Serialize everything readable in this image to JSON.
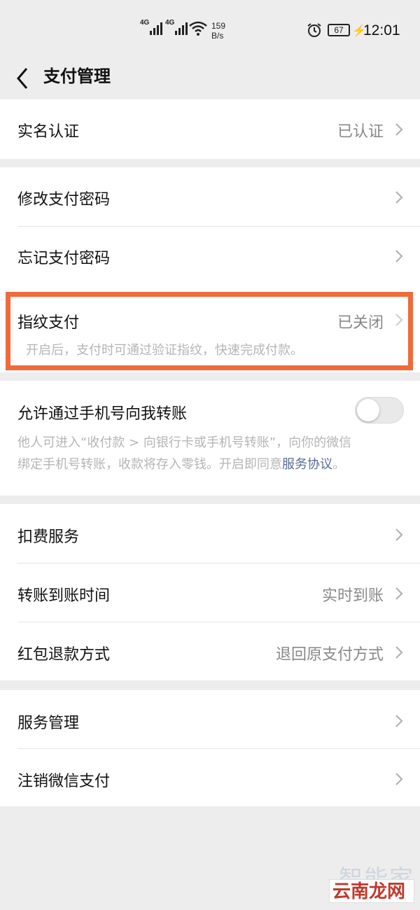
{
  "status_bar": {
    "net1": "4G",
    "net2": "4G",
    "speed_value": "159",
    "speed_unit": "B/s",
    "battery": "67",
    "time": "12:01"
  },
  "nav": {
    "title": "支付管理"
  },
  "rows": {
    "real_name": {
      "label": "实名认证",
      "value": "已认证"
    },
    "change_pwd": {
      "label": "修改支付密码"
    },
    "forgot_pwd": {
      "label": "忘记支付密码"
    },
    "fingerprint": {
      "label": "指纹支付",
      "value": "已关闭",
      "desc": "开启后，支付时可通过验证指纹，快速完成付款。"
    },
    "phone_transfer": {
      "label": "允许通过手机号向我转账",
      "desc_line1": "他人可进入“收付款 > 向银行卡或手机号转账”，向你的微信",
      "desc_line2_pre": "绑定手机号转账，收款将存入零钱。开启即同意",
      "desc_link": "服务协议",
      "desc_line2_post": "。",
      "toggle_on": false
    },
    "deduction": {
      "label": "扣费服务"
    },
    "transfer_time": {
      "label": "转账到账时间",
      "value": "实时到账"
    },
    "red_packet_refund": {
      "label": "红包退款方式",
      "value": "退回原支付方式"
    },
    "service_mgmt": {
      "label": "服务管理"
    },
    "cancel_pay": {
      "label": "注销微信支付"
    }
  },
  "watermark": {
    "top": "智能家",
    "bottom": "云南龙网"
  },
  "colors": {
    "background": "#ededed",
    "highlight": "#f06a3c",
    "link": "#576b95"
  }
}
